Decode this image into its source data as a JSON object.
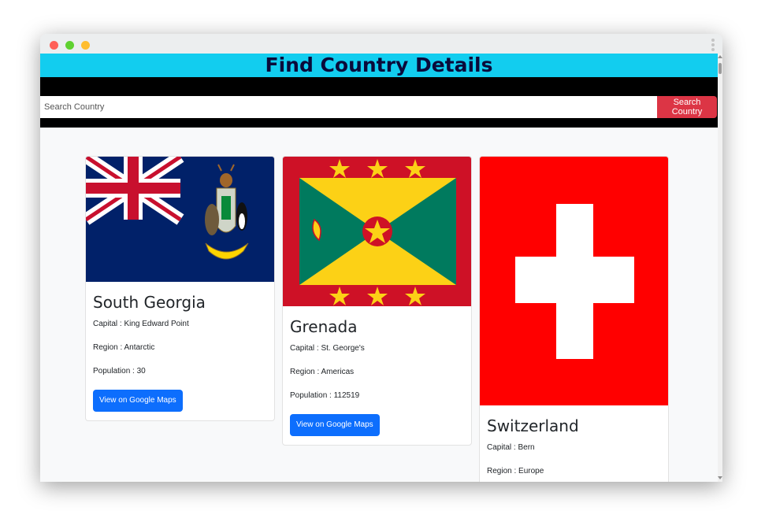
{
  "header": {
    "title": "Find Country Details"
  },
  "search": {
    "placeholder": "Search Country",
    "button_label": "Search Country"
  },
  "cards": [
    {
      "name": "South Georgia",
      "capital_label": "Capital : King Edward Point",
      "region_label": "Region : Antarctic",
      "population_label": "Population : 30",
      "maps_button": "View on Google Maps"
    },
    {
      "name": "Grenada",
      "capital_label": "Capital : St. George's",
      "region_label": "Region : Americas",
      "population_label": "Population : 112519",
      "maps_button": "View on Google Maps"
    },
    {
      "name": "Switzerland",
      "capital_label": "Capital : Bern",
      "region_label": "Region : Europe"
    }
  ],
  "colors": {
    "header_bg": "#12cdef",
    "search_button": "#dc3545",
    "maps_button": "#0d6efd",
    "swiss_red": "#ff0000",
    "grenada_red": "#ce1126",
    "grenada_yellow": "#fcd116",
    "grenada_green": "#007a5e",
    "sgs_blue": "#012169"
  },
  "icons": [
    "close-dot",
    "minimize-dot",
    "maximize-dot",
    "kebab-menu-icon"
  ]
}
